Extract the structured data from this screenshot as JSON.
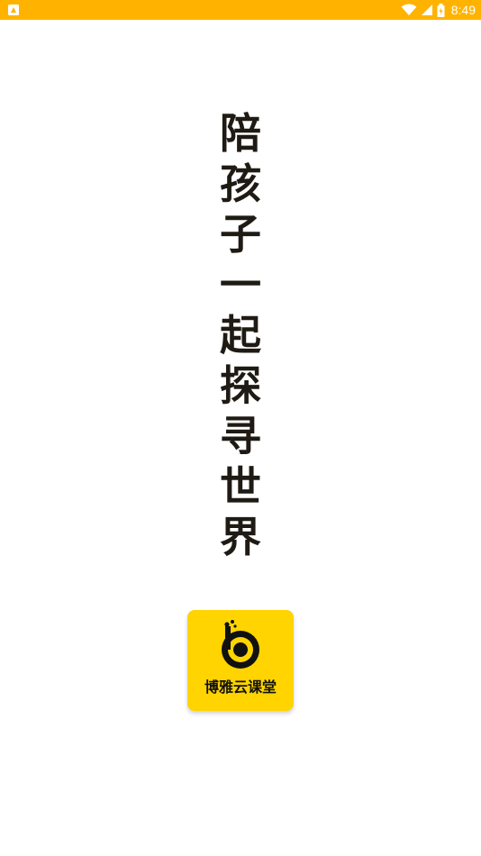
{
  "status_bar": {
    "time": "8:49",
    "background_color": "#FFB300",
    "icons": [
      "notification-icon",
      "wifi-icon",
      "signal-icon",
      "battery-icon"
    ]
  },
  "slogan": {
    "chars": [
      "陪",
      "孩",
      "子",
      "一",
      "起",
      "探",
      "寻",
      "世",
      "界"
    ]
  },
  "app_logo": {
    "name": "博雅云课堂",
    "background_color": "#FFD400"
  }
}
